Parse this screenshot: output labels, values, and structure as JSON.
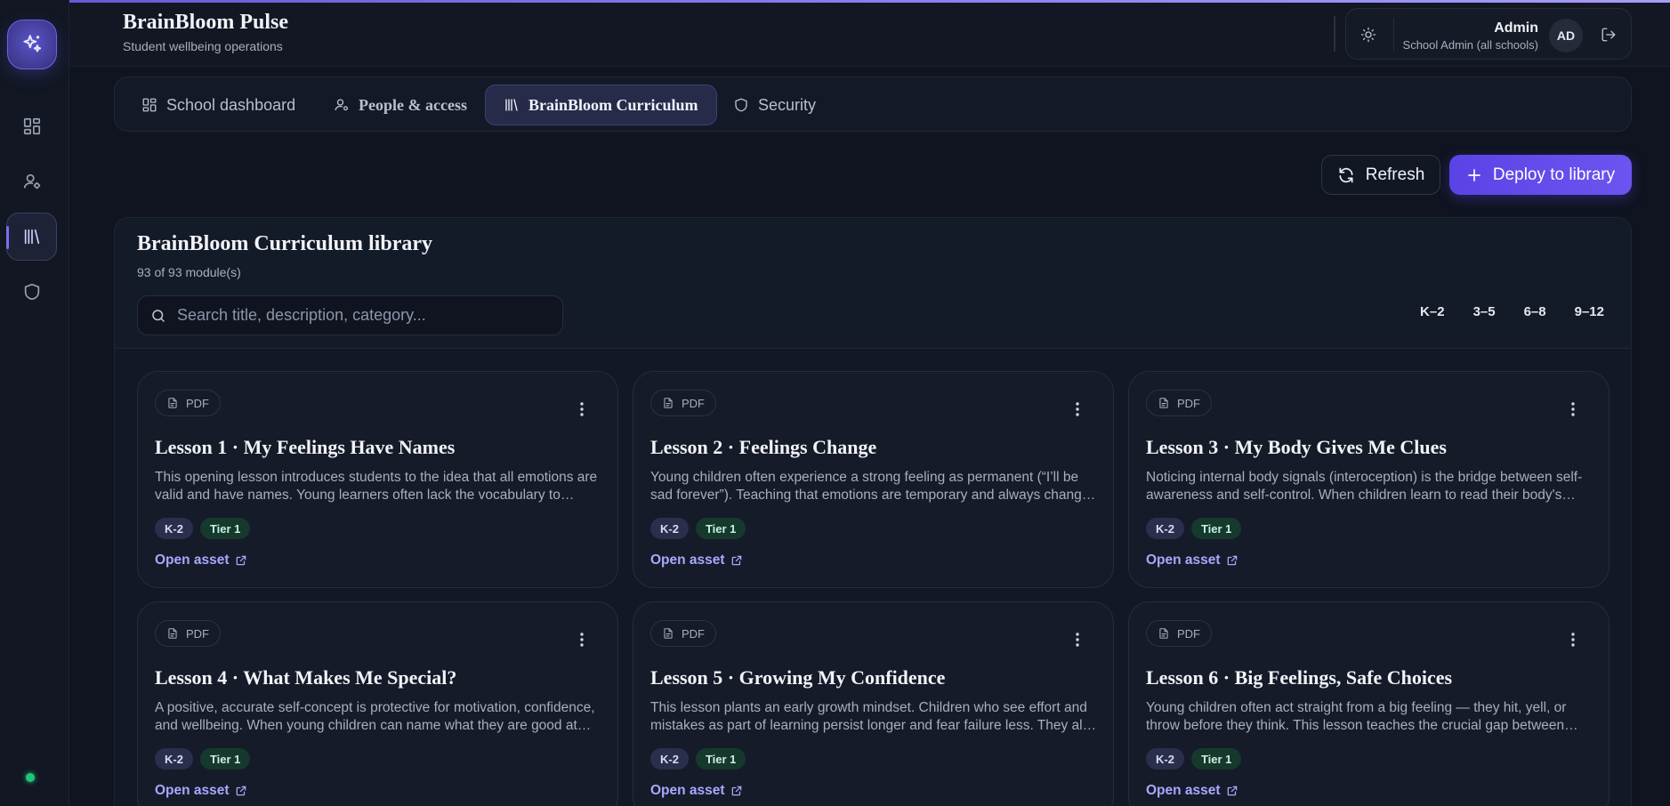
{
  "app": {
    "title": "BrainBloom Pulse",
    "subtitle": "Student wellbeing operations"
  },
  "user": {
    "name": "Admin",
    "role": "School Admin (all schools)",
    "initials": "AD"
  },
  "tabs": [
    {
      "label": "School dashboard"
    },
    {
      "label": "People & access"
    },
    {
      "label": "BrainBloom Curriculum"
    },
    {
      "label": "Security"
    }
  ],
  "actions": {
    "refresh": "Refresh",
    "deploy": "Deploy to library"
  },
  "library": {
    "title": "BrainBloom Curriculum library",
    "count": "93 of 93 module(s)",
    "search_placeholder": "Search title, description, category...",
    "grades": [
      "K–2",
      "3–5",
      "6–8",
      "9–12"
    ],
    "open_asset_label": "Open asset",
    "cards": [
      {
        "type": "PDF",
        "title": "Lesson 1 · My Feelings Have Names",
        "description": "This opening lesson introduces students to the idea that all emotions are valid and have names. Young learners often lack the vocabulary to describe what they feel.",
        "grade": "K-2",
        "tier": "Tier 1"
      },
      {
        "type": "PDF",
        "title": "Lesson 2 · Feelings Change",
        "description": "Young children often experience a strong feeling as permanent (“I’ll be sad forever”). Teaching that emotions are temporary and always change helps children cope.",
        "grade": "K-2",
        "tier": "Tier 1"
      },
      {
        "type": "PDF",
        "title": "Lesson 3 · My Body Gives Me Clues",
        "description": "Noticing internal body signals (interoception) is the bridge between self-awareness and self-control. When children learn to read their body's signals they can respond.",
        "grade": "K-2",
        "tier": "Tier 1"
      },
      {
        "type": "PDF",
        "title": "Lesson 4 · What Makes Me Special?",
        "description": "A positive, accurate self-concept is protective for motivation, confidence, and wellbeing. When young children can name what they are good at they build resilience.",
        "grade": "K-2",
        "tier": "Tier 1"
      },
      {
        "type": "PDF",
        "title": "Lesson 5 · Growing My Confidence",
        "description": "This lesson plants an early growth mindset. Children who see effort and mistakes as part of learning persist longer and fear failure less. They also try new things.",
        "grade": "K-2",
        "tier": "Tier 1"
      },
      {
        "type": "PDF",
        "title": "Lesson 6 · Big Feelings, Safe Choices",
        "description": "Young children often act straight from a big feeling — they hit, yell, or throw before they think. This lesson teaches the crucial gap between feeling and action.",
        "grade": "K-2",
        "tier": "Tier 1"
      }
    ]
  },
  "colors": {
    "accent": "#5a43e6",
    "background": "#0f1420",
    "link": "#a7a9ff",
    "online": "#22c37a"
  }
}
